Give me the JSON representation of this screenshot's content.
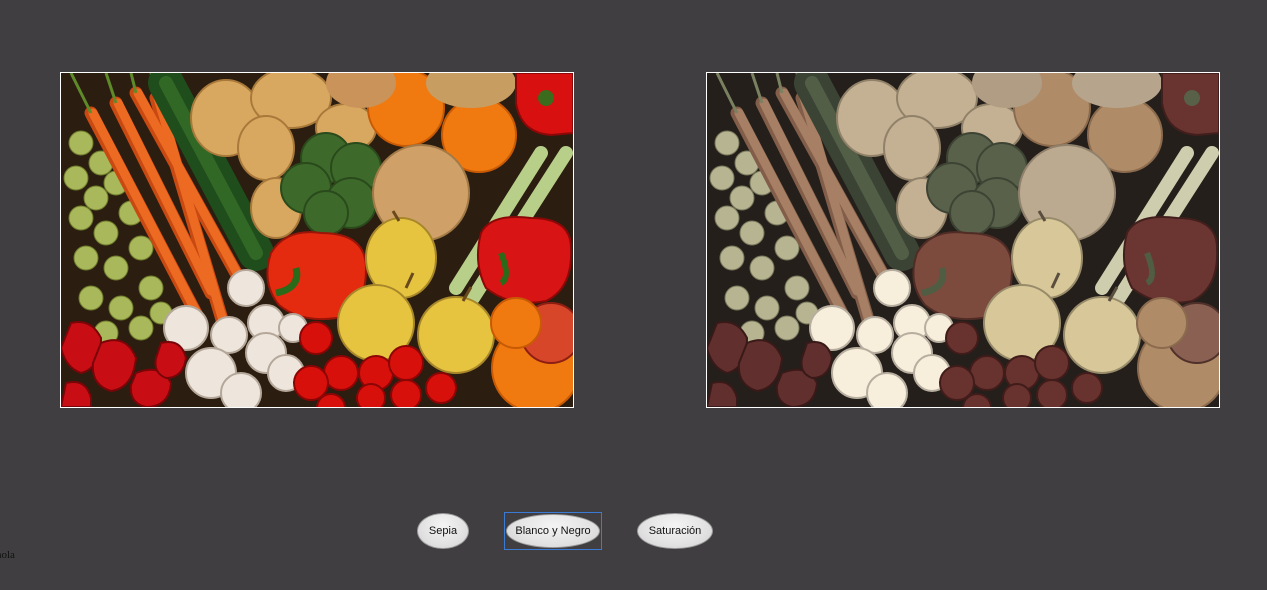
{
  "images": {
    "original": {
      "icon": "vegetables-photo",
      "description_name": "original-image"
    },
    "filtered": {
      "icon": "vegetables-photo-filtered",
      "description_name": "filtered-image"
    }
  },
  "buttons": {
    "sepia_label": "Sepia",
    "bw_label": "Blanco y Negro",
    "saturation_label": "Saturación"
  },
  "status": {
    "corner_text": "hola"
  },
  "colors": {
    "background": "#403e40",
    "frame_border": "#ffffff",
    "focus_border": "#3a7bd5"
  }
}
